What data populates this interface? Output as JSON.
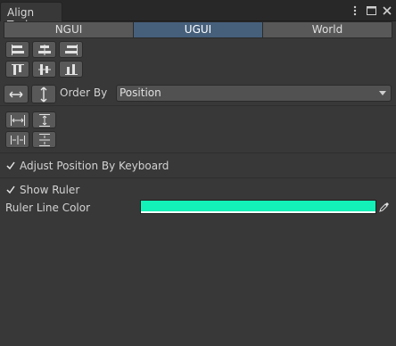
{
  "window": {
    "tab_title": "Align Tools",
    "menu_icon": "kebab-menu-icon",
    "maximize_icon": "maximize-icon",
    "close_icon": "close-icon"
  },
  "modes": {
    "items": [
      "NGUI",
      "UGUI",
      "World"
    ],
    "selected": "UGUI"
  },
  "align_buttons": {
    "row1": [
      "align-left-icon",
      "align-center-horizontal-icon",
      "align-right-icon"
    ],
    "row2": [
      "align-top-icon",
      "align-center-vertical-icon",
      "align-bottom-icon"
    ]
  },
  "order": {
    "horizontal_icon": "horizontal-order-icon",
    "vertical_icon": "vertical-order-icon",
    "label": "Order By",
    "selected": "Position"
  },
  "distribute_buttons": {
    "row1": [
      "distribute-horizontal-icon",
      "distribute-vertical-icon"
    ],
    "row2": [
      "distribute-horizontal-gap-icon",
      "distribute-vertical-gap-icon"
    ]
  },
  "options": {
    "adjust_by_keyboard": {
      "label": "Adjust Position By Keyboard",
      "checked": true
    },
    "show_ruler": {
      "label": "Show Ruler",
      "checked": true
    }
  },
  "ruler": {
    "color_label": "Ruler Line Color",
    "color": "#13f1b8",
    "picker_icon": "eyedropper-icon"
  },
  "colors": {
    "background": "#383838",
    "titlebar": "#282828",
    "button": "#595959",
    "selected_mode": "#46607c"
  }
}
